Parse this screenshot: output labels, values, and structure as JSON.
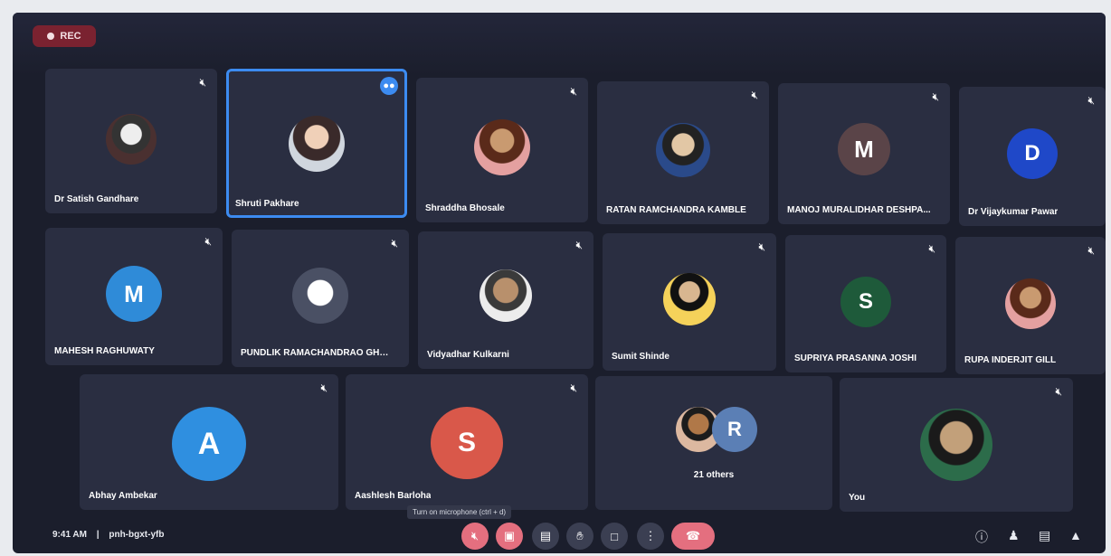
{
  "recording": {
    "label": "REC"
  },
  "tiles": [
    {
      "name": "Dr Satish Gandhare",
      "avatar_type": "photo"
    },
    {
      "name": "Shruti Pakhare",
      "avatar_type": "photo",
      "active": true
    },
    {
      "name": "Shraddha Bhosale",
      "avatar_type": "photo"
    },
    {
      "name": "RATAN RAMCHANDRA KAMBLE",
      "avatar_type": "photo"
    },
    {
      "name": "MANOJ MURALIDHAR DESHPA...",
      "avatar_type": "initial",
      "initial": "M",
      "color": "#5a4448"
    },
    {
      "name": "Dr Vijaykumar Pawar",
      "avatar_type": "initial",
      "initial": "D",
      "color": "#1f48c8"
    },
    {
      "name": "MAHESH RAGHUWATY",
      "avatar_type": "initial",
      "initial": "M",
      "color": "#2f8bd8"
    },
    {
      "name": "PUNDLIK RAMACHANDRAO GHATE",
      "avatar_type": "photo"
    },
    {
      "name": "Vidyadhar Kulkarni",
      "avatar_type": "photo"
    },
    {
      "name": "Sumit Shinde",
      "avatar_type": "photo"
    },
    {
      "name": "SUPRIYA PRASANNA JOSHI",
      "avatar_type": "initial",
      "initial": "S",
      "color": "#1e5a3a"
    },
    {
      "name": "RUPA INDERJIT GILL",
      "avatar_type": "photo"
    },
    {
      "name": "Abhay Ambekar",
      "avatar_type": "initial",
      "initial": "A",
      "color": "#2f8fe0"
    },
    {
      "name": "Aashlesh Barloha",
      "avatar_type": "initial",
      "initial": "S",
      "color": "#d9584a"
    },
    {
      "name": "21 others",
      "avatar_type": "others",
      "initial": "R",
      "color": "#5b7fb5"
    },
    {
      "name": "You",
      "avatar_type": "photo"
    }
  ],
  "tooltip": {
    "text": "Turn on microphone (ctrl + d)"
  },
  "bottom_bar": {
    "time": "9:41 AM",
    "separator": "|",
    "meeting_code": "pnh-bgxt-yfb",
    "controls": [
      {
        "name": "mic-off",
        "icon": "mic-off-icon",
        "style": "red"
      },
      {
        "name": "camera-off",
        "icon": "camera-off-icon",
        "style": "red"
      },
      {
        "name": "captions",
        "icon": "captions-icon",
        "style": "dark"
      },
      {
        "name": "raise-hand",
        "icon": "hand-icon",
        "style": "dark"
      },
      {
        "name": "present",
        "icon": "present-icon",
        "style": "dark"
      },
      {
        "name": "more",
        "icon": "more-icon",
        "style": "dark"
      },
      {
        "name": "leave-call",
        "icon": "end-call-icon",
        "style": "end"
      }
    ],
    "right_icons": [
      "info-icon",
      "people-icon",
      "chat-icon",
      "activities-icon"
    ]
  }
}
